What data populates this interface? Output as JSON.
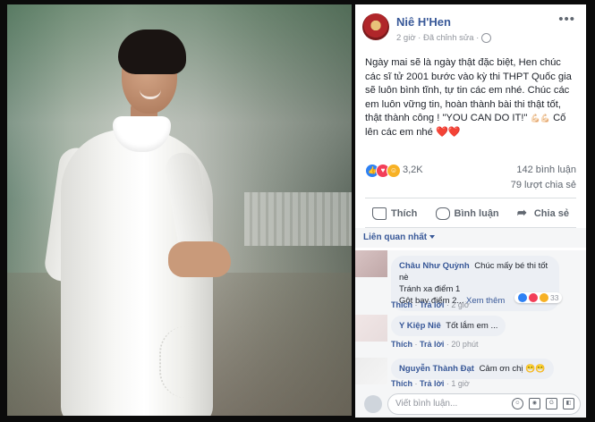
{
  "post": {
    "author": "Niê H'Hen",
    "meta": "2 giờ · Đã chỉnh sửa ·",
    "more": "•••",
    "body_main": "Ngày mai sẽ là ngày thật đặc biệt, Hen chúc các sĩ tử 2001 bước vào kỳ thi THPT Quốc gia sẽ luôn bình tĩnh, tự tin các em nhé. Chúc các em luôn vững tin, hoàn thành bài thi thật tốt, thật thành công ! \"YOU CAN DO IT!\"",
    "body_emoji": "💪🏻💪🏻",
    "body_end": "Cố lên các em nhé",
    "body_hearts": "❤️❤️",
    "reaction_count": "3,2K",
    "comment_count": "142 bình luận",
    "share_count": "79 lượt chia sẻ"
  },
  "actions": {
    "like": "Thích",
    "comment": "Bình luận",
    "share": "Chia sẻ"
  },
  "sort": {
    "label": "Liên quan nhất"
  },
  "comments": [
    {
      "author": "Châu Như Quỳnh",
      "text_l1": "Chúc mấy bé thi tốt nè",
      "text_l2": "Tránh xa điểm 1",
      "text_l3": "Gột bay điểm 2...",
      "see_more": "Xem thêm",
      "like": "Thích",
      "reply": "Trả lời",
      "time": "2 giờ",
      "reacts": "33"
    },
    {
      "author": "Y Kiệp Niê",
      "text": "Tốt lắm em ...",
      "like": "Thích",
      "reply": "Trả lời",
      "time": "20 phút"
    },
    {
      "author": "Nguyễn Thành Đạt",
      "text": "Cảm ơn chị",
      "emoji": "😁😁",
      "like": "Thích",
      "reply": "Trả lời",
      "time": "1 giờ"
    }
  ],
  "composer": {
    "placeholder": "Viết bình luận..."
  }
}
